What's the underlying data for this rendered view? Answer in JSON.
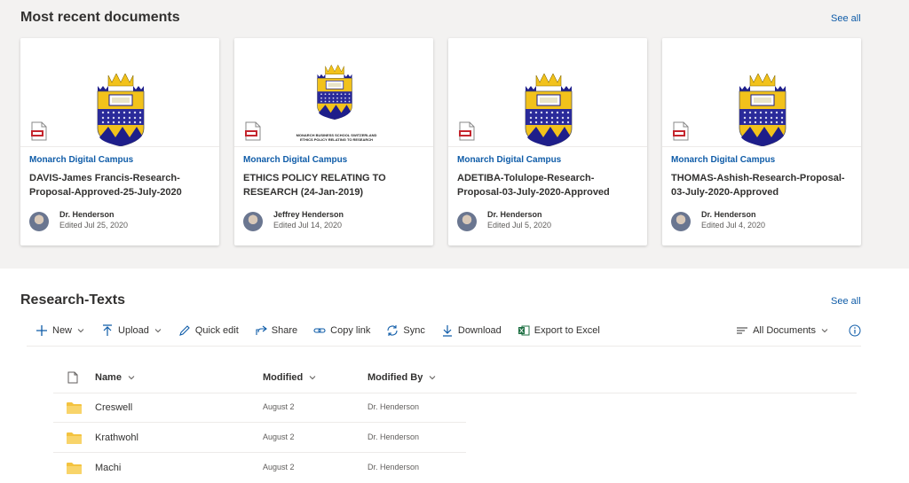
{
  "recent": {
    "title": "Most recent documents",
    "see_all": "See all",
    "cards": [
      {
        "site": "Monarch Digital Campus",
        "title": "DAVIS-James Francis-Research-Proposal-Approved-25-July-2020",
        "author": "Dr. Henderson",
        "edited": "Edited Jul 25, 2020"
      },
      {
        "site": "Monarch Digital Campus",
        "title": "ETHICS POLICY RELATING TO RESEARCH (24-Jan-2019)",
        "author": "Jeffrey Henderson",
        "edited": "Edited Jul 14, 2020",
        "thumb_caption_1": "MONARCH BUSINESS SCHOOL SWITZERLAND",
        "thumb_caption_2": "ETHICS POLICY RELATING TO RESEARCH"
      },
      {
        "site": "Monarch Digital Campus",
        "title": "ADETIBA-Tolulope-Research-Proposal-03-July-2020-Approved",
        "author": "Dr. Henderson",
        "edited": "Edited Jul 5, 2020"
      },
      {
        "site": "Monarch Digital Campus",
        "title": "THOMAS-Ashish-Research-Proposal-03-July-2020-Approved",
        "author": "Dr. Henderson",
        "edited": "Edited Jul 4, 2020"
      }
    ]
  },
  "library": {
    "title": "Research-Texts",
    "see_all": "See all",
    "toolbar": {
      "new": "New",
      "upload": "Upload",
      "quick_edit": "Quick edit",
      "share": "Share",
      "copy_link": "Copy link",
      "sync": "Sync",
      "download": "Download",
      "export": "Export to Excel",
      "view": "All Documents"
    },
    "columns": {
      "name": "Name",
      "modified": "Modified",
      "modified_by": "Modified By"
    },
    "rows": [
      {
        "name": "Creswell",
        "modified": "August 2",
        "modified_by": "Dr. Henderson"
      },
      {
        "name": "Krathwohl",
        "modified": "August 2",
        "modified_by": "Dr. Henderson"
      },
      {
        "name": "Machi",
        "modified": "August 2",
        "modified_by": "Dr. Henderson"
      }
    ]
  },
  "colors": {
    "accent": "#0f5ca8",
    "crest_gold": "#f2c21b",
    "crest_blue": "#1e1e8a",
    "folder": "#f4c33f",
    "pdf_red": "#c4262e"
  },
  "icons": [
    "pdf-icon",
    "crest-logo",
    "plus-icon",
    "upload-icon",
    "pencil-icon",
    "share-icon",
    "link-icon",
    "sync-icon",
    "download-icon",
    "excel-icon",
    "list-icon",
    "info-icon",
    "file-icon",
    "folder-icon",
    "chevron-down-icon"
  ]
}
